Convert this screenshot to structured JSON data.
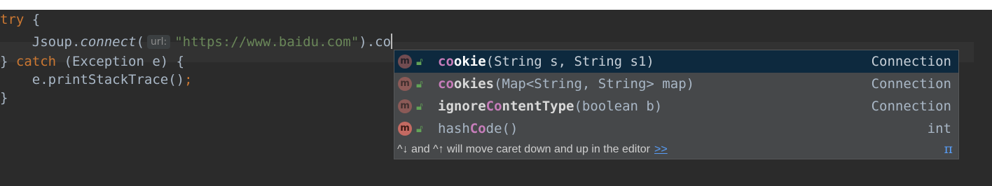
{
  "editor": {
    "line1": {
      "kw_try": "try",
      "brace": " {"
    },
    "line2": {
      "indent": "    ",
      "object": "Jsoup.",
      "method": "connect",
      "open": "(",
      "param_hint": "url:",
      "string_literal": "\"https://www.baidu.com\"",
      "close": ").co"
    },
    "line3": {
      "rbrace": "} ",
      "kw_catch": "catch",
      "rest": " (Exception e) {"
    },
    "line4": {
      "indent": "    ",
      "code": "e.printStackTrace()",
      "semicolon": ";"
    },
    "line5": {
      "rbrace": "}"
    }
  },
  "completion": {
    "items": [
      {
        "icon": "m",
        "name_match": "co",
        "name_rest": "okie",
        "params": "(String s, String s1)",
        "return_type": "Connection",
        "selected": true
      },
      {
        "icon": "m",
        "name_match": "co",
        "name_rest": "okies",
        "params": "(Map<String, String> map)",
        "return_type": "Connection"
      },
      {
        "icon": "m",
        "name_pre": "ignore",
        "name_match": "Co",
        "name_rest": "ntentType",
        "params": "(boolean b)",
        "return_type": "Connection"
      },
      {
        "icon": "m",
        "name_pre": "hash",
        "name_match": "Co",
        "name_rest": "de",
        "params": "()",
        "return_type": "int"
      }
    ],
    "footer_text": "^↓ and ^↑ will move caret down and up in the editor",
    "footer_link": ">>",
    "footer_pi": "π"
  }
}
